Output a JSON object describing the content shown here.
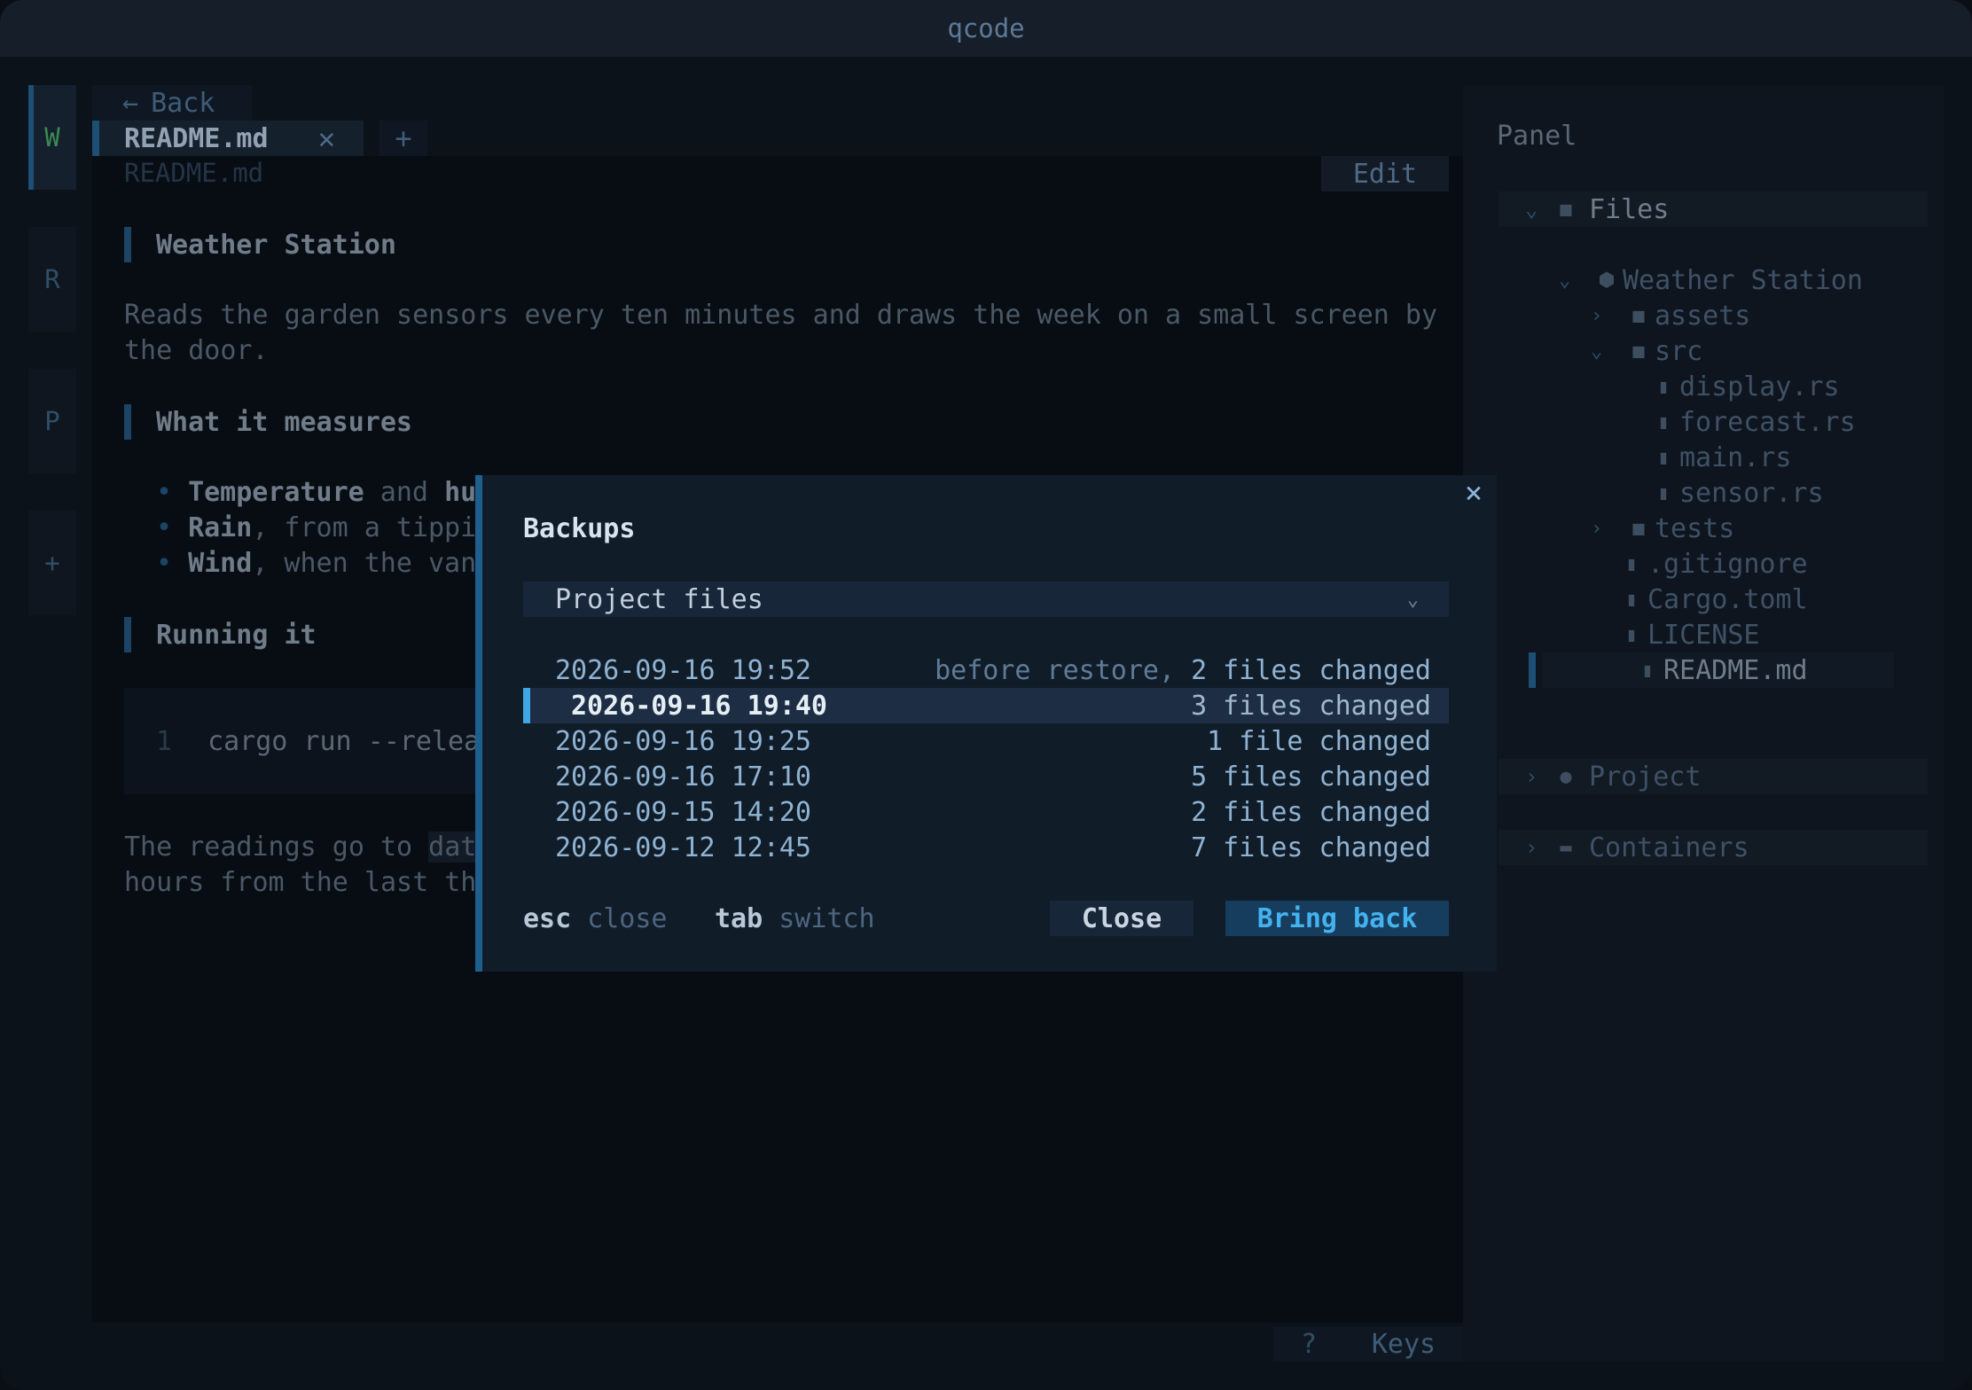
{
  "window": {
    "title": "qcode"
  },
  "activity_bar": {
    "items": [
      "W",
      "R",
      "P",
      "+"
    ]
  },
  "editor": {
    "back_label": "Back",
    "tab_label": "README.md",
    "tab_close": "✕",
    "tab_add": "+",
    "breadcrumb": "README.md",
    "edit_label": "Edit",
    "heading1": "Weather Station",
    "intro_line1": "Reads the garden sensors every ten minutes and draws the week on a small screen by",
    "intro_line2": "the door.",
    "heading2": "What it measures",
    "bullets": [
      {
        "bold": "Temperature",
        "rest": " and ",
        "bold2": "hu"
      },
      {
        "bold": "Rain",
        "rest": ", from a tippi"
      },
      {
        "bold": "Wind",
        "rest": ", when the van"
      }
    ],
    "heading3": "Running it",
    "code_line_number": "1",
    "code_line": "cargo run --relea",
    "footer_line1_a": "The readings go to ",
    "footer_line1_code": "dat",
    "footer_line2": "hours from the last th"
  },
  "status": {
    "help": "?",
    "keys": "Keys"
  },
  "panel": {
    "title": "Panel",
    "files_label": "Files",
    "project_label": "Project",
    "containers_label": "Containers",
    "tree": {
      "root": "Weather Station",
      "assets": "assets",
      "src": "src",
      "src_files": [
        "display.rs",
        "forecast.rs",
        "main.rs",
        "sensor.rs"
      ],
      "tests": "tests",
      "root_files": [
        ".gitignore",
        "Cargo.toml",
        "LICENSE"
      ],
      "selected": "README.md"
    }
  },
  "modal": {
    "title": "Backups",
    "close_icon": "×",
    "scope_value": "Project files",
    "backups": [
      {
        "date": "2026-09-16 19:52",
        "note": "before restore, ",
        "changes": "2 files changed"
      },
      {
        "date": "2026-09-16 19:40",
        "note": "",
        "changes": "3 files changed"
      },
      {
        "date": "2026-09-16 19:25",
        "note": "",
        "changes": "1 file changed"
      },
      {
        "date": "2026-09-16 17:10",
        "note": "",
        "changes": "5 files changed"
      },
      {
        "date": "2026-09-15 14:20",
        "note": "",
        "changes": "2 files changed"
      },
      {
        "date": "2026-09-12 12:45",
        "note": "",
        "changes": "7 files changed"
      }
    ],
    "hint_esc_key": "esc",
    "hint_esc_label": "close",
    "hint_tab_key": "tab",
    "hint_tab_label": "switch",
    "close_button": "Close",
    "bring_back_button": "Bring back"
  }
}
